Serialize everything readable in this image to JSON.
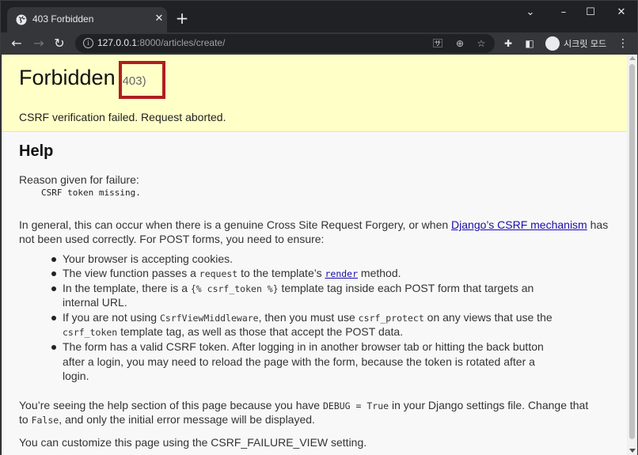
{
  "browser": {
    "tab": {
      "title": "403 Forbidden",
      "favicon": "globe-icon"
    },
    "address_bar": {
      "url_host": "127.0.0.1",
      "url_rest": ":8000/articles/create/"
    },
    "profile": {
      "label": "시크릿 모드"
    }
  },
  "page": {
    "summary": {
      "heading": "Forbidden",
      "status_code": "(403)",
      "message": "CSRF verification failed. Request aborted."
    },
    "help": {
      "heading": "Help",
      "reason_label": "Reason given for failure:",
      "reason_value": "CSRF token missing.",
      "intro_line1_pre": "In general, this can occur when there is a genuine Cross Site Request Forgery, or when ",
      "intro_link": "Django’s CSRF mechanism",
      "intro_line1_post": " has",
      "intro_line2": "not been used correctly. For POST forms, you need to ensure:",
      "items": [
        {
          "lines": [
            "Your browser is accepting cookies."
          ]
        },
        {
          "pre": "The view function passes a ",
          "code": "request",
          "mid": " to the template’s ",
          "link": "render",
          "post": " method."
        },
        {
          "a": "In the template, there is a ",
          "code": "{% csrf_token %}",
          "b": " template tag inside each POST form that targets an",
          "line2": "internal URL."
        },
        {
          "a": "If you are not using ",
          "code1": "CsrfViewMiddleware",
          "b": ", then you must use ",
          "code2": "csrf_protect",
          "c": " on any views that use the",
          "code3": "csrf_token",
          "d": " template tag, as well as those that accept the POST data."
        },
        {
          "lines": [
            "The form has a valid CSRF token. After logging in in another browser tab or hitting the back button",
            "after a login, you may need to reload the page with the form, because the token is rotated after a",
            "login."
          ]
        }
      ],
      "debug_line1_pre": "You’re seeing the help section of this page because you have ",
      "debug_code": "DEBUG = True",
      "debug_line1_post": " in your Django settings file. Change that",
      "debug_line2_pre": "to ",
      "debug_code2": "False",
      "debug_line2_post": ", and only the initial error message will be displayed.",
      "customize": "You can customize this page using the CSRF_FAILURE_VIEW setting."
    }
  },
  "colors": {
    "summary_bg": "#ffffc8",
    "highlight": "#b01e1e",
    "link": "#1a0dab"
  }
}
